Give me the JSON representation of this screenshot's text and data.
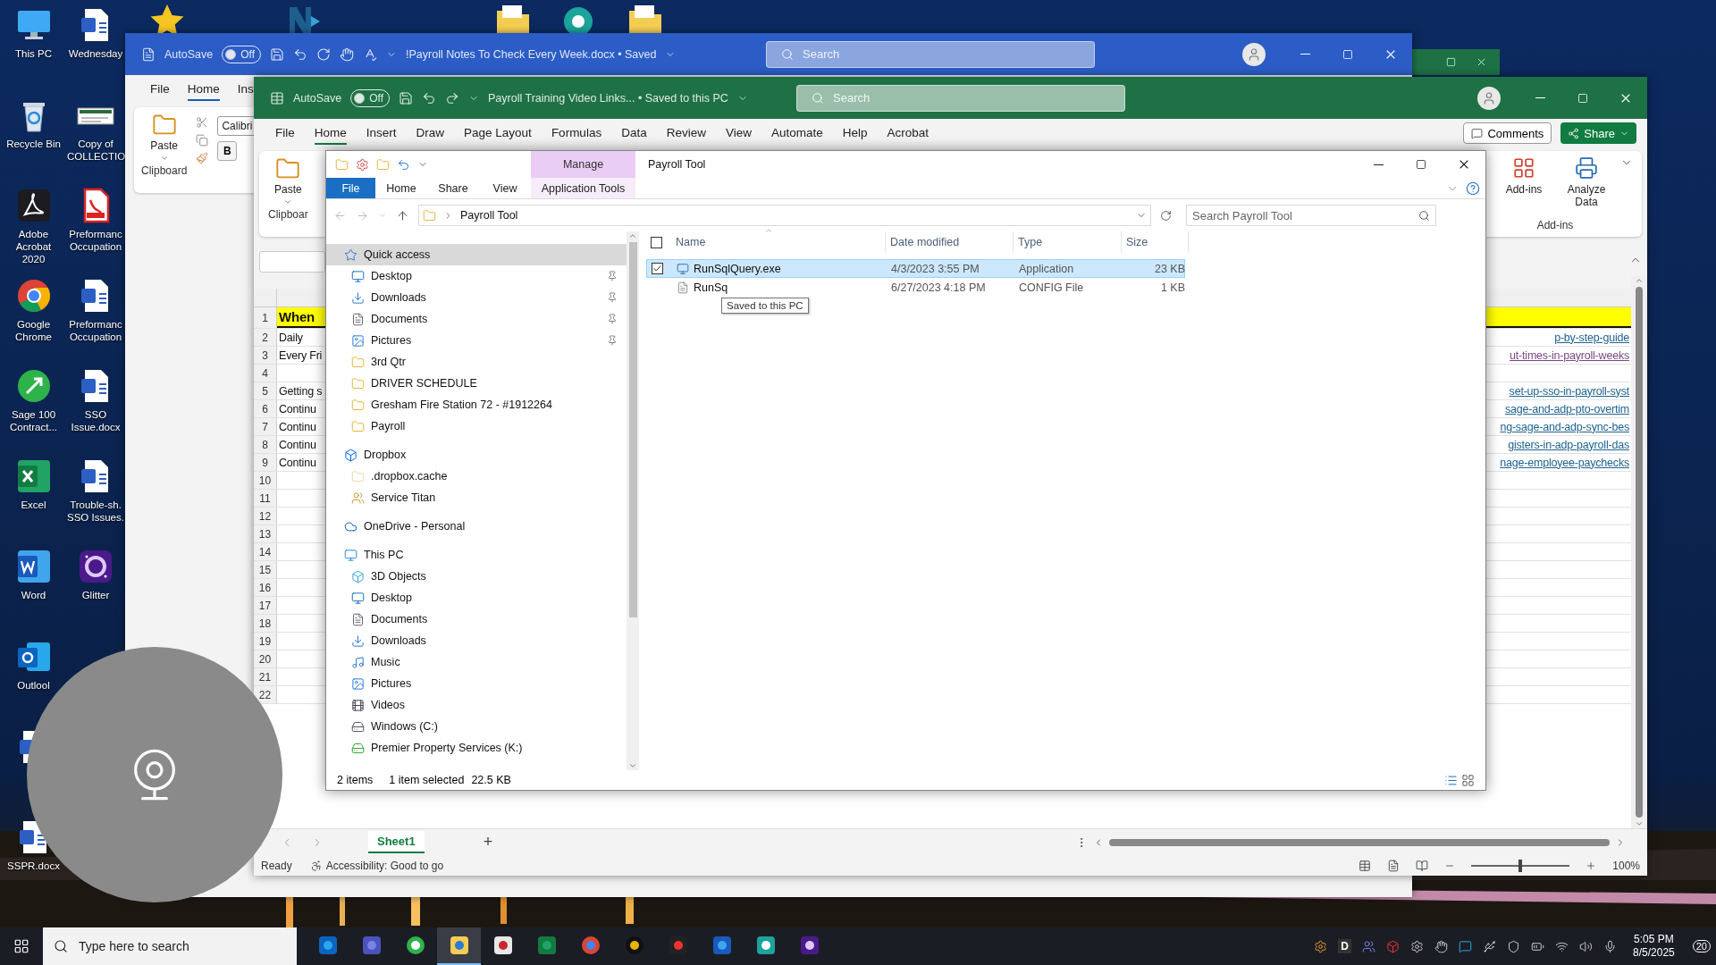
{
  "desktop": {
    "top_icons": [
      {
        "kind": "star"
      },
      {
        "kind": "logo"
      },
      {
        "kind": "folder"
      },
      {
        "kind": "gear"
      },
      {
        "kind": "folder"
      }
    ],
    "icons": [
      {
        "label": "This PC",
        "kind": "pc"
      },
      {
        "label": "Wednesday",
        "kind": "word-doc"
      },
      {
        "label": "Recycle Bin",
        "kind": "bin"
      },
      {
        "label": "Copy of COLLECTIO",
        "kind": "thumbnail"
      },
      {
        "label": "Adobe Acrobat 2020",
        "kind": "acrobat"
      },
      {
        "label": "Preformanc Occupation",
        "kind": "pdf"
      },
      {
        "label": "Google Chrome",
        "kind": "chrome"
      },
      {
        "label": "Preformanc Occupation",
        "kind": "word-doc"
      },
      {
        "label": "Sage 100 Contract...",
        "kind": "sage"
      },
      {
        "label": "SSO Issue.docx",
        "kind": "word-doc"
      },
      {
        "label": "Excel",
        "kind": "excel"
      },
      {
        "label": "Trouble-sh. SSO Issues.",
        "kind": "word-doc"
      },
      {
        "label": "Word",
        "kind": "word"
      },
      {
        "label": "Glitter",
        "kind": "glitter"
      },
      {
        "label": "Outlool",
        "kind": "outlook"
      },
      {
        "kind": "empty"
      },
      {
        "kind": "word-doc"
      },
      {
        "kind": "empty"
      },
      {
        "label": "SSPR.docx",
        "kind": "word-doc"
      }
    ]
  },
  "word": {
    "autosave": "AutoSave",
    "autosave_on": false,
    "autosave_state": "Off",
    "title": "!Payroll Notes To Check Every Week.docx • Saved",
    "search": "Search",
    "tabs": [
      {
        "label": "File",
        "selected": false
      },
      {
        "label": "Home",
        "selected": true
      },
      {
        "label": "Ins",
        "selected": false
      }
    ],
    "paste": "Paste",
    "font": "Calibri",
    "bold": "B",
    "group": "Clipboard"
  },
  "excel": {
    "autosave": "AutoSave",
    "autosave_on": false,
    "autosave_state": "Off",
    "title": "Payroll Training Video Links... • Saved to this PC",
    "search": "Search",
    "tabs": [
      {
        "label": "File",
        "selected": false
      },
      {
        "label": "Home",
        "selected": true
      },
      {
        "label": "Insert",
        "selected": false
      },
      {
        "label": "Draw",
        "selected": false
      },
      {
        "label": "Page Layout",
        "selected": false
      },
      {
        "label": "Formulas",
        "selected": false
      },
      {
        "label": "Data",
        "selected": false
      },
      {
        "label": "Review",
        "selected": false
      },
      {
        "label": "View",
        "selected": false
      },
      {
        "label": "Automate",
        "selected": false
      },
      {
        "label": "Help",
        "selected": false
      },
      {
        "label": "Acrobat",
        "selected": false
      }
    ],
    "comments": "Comments",
    "share": "Share",
    "ribbon": {
      "paste": "Paste",
      "clipboard": "Clipboar",
      "addins": "Add-ins",
      "analyze": "Analyze Data",
      "addins_group": "Add-ins"
    },
    "rows": [
      {
        "number": "1",
        "a": "When",
        "kind": "header"
      },
      {
        "number": "2",
        "a": "Daily",
        "link": "p-by-step-guide",
        "visited": false,
        "kind": "plain"
      },
      {
        "number": "3",
        "a": "Every Fri",
        "link": "ut-times-in-payroll-weeks",
        "visited": true,
        "kind": "plain"
      },
      {
        "number": "4",
        "kind": "plain"
      },
      {
        "number": "5",
        "a": "Getting s",
        "link": "set-up-sso-in-payroll-syst",
        "visited": false,
        "kind": "plain"
      },
      {
        "number": "6",
        "a": "Continu",
        "link": "sage-and-adp-pto-overtim",
        "visited": false,
        "kind": "plain"
      },
      {
        "number": "7",
        "a": "Continu",
        "link": "ng-sage-and-adp-sync-bes",
        "visited": false,
        "kind": "plain"
      },
      {
        "number": "8",
        "a": "Continu",
        "link": "gisters-in-adp-payroll-das",
        "visited": false,
        "kind": "plain"
      },
      {
        "number": "9",
        "a": "Continu",
        "link": "nage-employee-paychecks",
        "visited": false,
        "kind": "plain"
      },
      {
        "number": "10",
        "kind": "plain"
      },
      {
        "number": "11",
        "kind": "plain"
      },
      {
        "number": "12",
        "kind": "plain"
      },
      {
        "number": "13",
        "kind": "plain"
      },
      {
        "number": "14",
        "kind": "plain"
      },
      {
        "number": "15",
        "kind": "plain"
      },
      {
        "number": "16",
        "kind": "plain"
      },
      {
        "number": "17",
        "kind": "plain"
      },
      {
        "number": "18",
        "kind": "plain"
      },
      {
        "number": "19",
        "kind": "plain"
      },
      {
        "number": "20",
        "kind": "plain"
      },
      {
        "number": "21",
        "kind": "plain"
      },
      {
        "number": "22",
        "kind": "plain"
      }
    ],
    "sheets": [
      {
        "label": "Sheet1",
        "selected": true
      }
    ],
    "add_sheet": "+",
    "status": "Ready",
    "accessibility": "Accessibility: Good to go",
    "zoom": "100%",
    "zoom_slider": {
      "level": 0.5
    }
  },
  "explorer": {
    "context_tab": "Manage",
    "title": "Payroll Tool",
    "tabs": [
      {
        "label": "File",
        "kind": "file"
      },
      {
        "label": "Home",
        "kind": "plain"
      },
      {
        "label": "Share",
        "kind": "plain"
      },
      {
        "label": "View",
        "kind": "plain"
      },
      {
        "label": "Application Tools",
        "kind": "context"
      }
    ],
    "select_all_checked": false,
    "address": "Payroll Tool",
    "search_placeholder": "Search Payroll Tool",
    "nav": [
      {
        "label": "Quick access",
        "kind": "star",
        "selected": true,
        "children": [
          {
            "label": "Desktop",
            "kind": "desktop",
            "pinned": true,
            "selected": false
          },
          {
            "label": "Downloads",
            "kind": "downloads",
            "pinned": true,
            "selected": false
          },
          {
            "label": "Documents",
            "kind": "documents",
            "pinned": true,
            "selected": false
          },
          {
            "label": "Pictures",
            "kind": "pictures",
            "pinned": true,
            "selected": false
          },
          {
            "label": "3rd Qtr",
            "kind": "folder",
            "pinned": false,
            "selected": false
          },
          {
            "label": "DRIVER SCHEDULE",
            "kind": "folder",
            "pinned": false,
            "selected": false
          },
          {
            "label": "Gresham Fire Station 72 - #1912264",
            "kind": "folder",
            "pinned": false,
            "selected": false
          },
          {
            "label": "Payroll",
            "kind": "folder",
            "pinned": false,
            "selected": false
          }
        ]
      },
      {
        "label": "Dropbox",
        "kind": "dropbox",
        "selected": false,
        "children": [
          {
            "label": ".dropbox.cache",
            "kind": "faded-folder",
            "selected": false
          },
          {
            "label": "Service Titan",
            "kind": "people-folder",
            "selected": false
          }
        ]
      },
      {
        "label": "OneDrive - Personal",
        "kind": "cloud",
        "selected": false
      },
      {
        "label": "This PC",
        "kind": "pc",
        "selected": false,
        "children": [
          {
            "label": "3D Objects",
            "kind": "cube",
            "selected": false
          },
          {
            "label": "Desktop",
            "kind": "desktop",
            "selected": false
          },
          {
            "label": "Documents",
            "kind": "documents",
            "selected": false
          },
          {
            "label": "Downloads",
            "kind": "downloads",
            "selected": false
          },
          {
            "label": "Music",
            "kind": "music",
            "selected": false
          },
          {
            "label": "Pictures",
            "kind": "pictures",
            "selected": false
          },
          {
            "label": "Videos",
            "kind": "videos",
            "selected": false
          },
          {
            "label": "Windows (C:)",
            "kind": "drive",
            "selected": false
          },
          {
            "label": "Premier Property Services (K:)",
            "kind": "network-drive",
            "selected": false
          }
        ]
      }
    ],
    "columns": [
      "Name",
      "Date modified",
      "Type",
      "Size"
    ],
    "files": [
      {
        "name": "RunSqlQuery.exe",
        "modified": "4/3/2023 3:55 PM",
        "type": "Application",
        "size": "23 KB",
        "kind": "exe",
        "selected": true
      },
      {
        "name": "RunSq",
        "modified": "6/27/2023 4:18 PM",
        "type": "CONFIG File",
        "size": "1 KB",
        "kind": "config",
        "selected": false
      }
    ],
    "tooltip": "Saved to this PC",
    "status": {
      "count": "2 items",
      "selection": "1 item selected",
      "size": "22.5 KB"
    }
  },
  "taskbar": {
    "search_placeholder": "Type here to search",
    "apps": [
      {
        "kind": "outlook",
        "active": false
      },
      {
        "kind": "teams",
        "active": false
      },
      {
        "kind": "sage",
        "active": false
      },
      {
        "kind": "explorer",
        "active": true
      },
      {
        "kind": "cloud-app",
        "active": false
      },
      {
        "kind": "excel",
        "active": false
      },
      {
        "kind": "chrome",
        "active": false
      },
      {
        "kind": "dark-round",
        "active": false
      },
      {
        "kind": "acrobat",
        "active": false
      },
      {
        "kind": "word",
        "active": false
      },
      {
        "kind": "knot",
        "active": false
      },
      {
        "kind": "glitter",
        "active": false
      }
    ],
    "tray_letter": "D",
    "time": "5:05 PM",
    "date": "8/5/2025",
    "notifications": "20"
  }
}
